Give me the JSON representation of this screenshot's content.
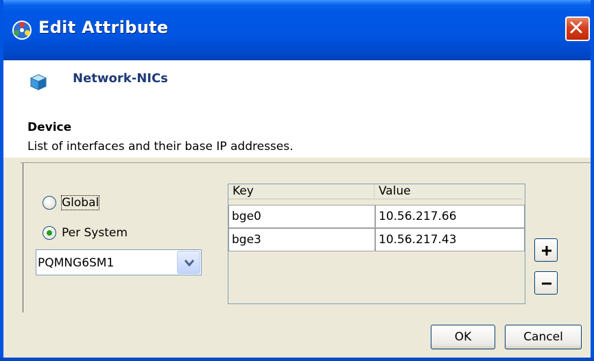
{
  "window": {
    "title": "Edit Attribute"
  },
  "header": {
    "title": "Network-NICs"
  },
  "section": {
    "title": "Device",
    "description": "List of interfaces and their base IP addresses."
  },
  "scope": {
    "global_label": "Global",
    "per_system_label": "Per System",
    "selected": "Per System",
    "system_value": "PQMNG6SM1"
  },
  "table": {
    "columns": [
      "Key",
      "Value"
    ],
    "rows": [
      {
        "key": "bge0",
        "value": "10.56.217.66"
      },
      {
        "key": "bge3",
        "value": "10.56.217.43"
      }
    ]
  },
  "buttons": {
    "add_label": "+",
    "remove_label": "−",
    "ok_label": "OK",
    "cancel_label": "Cancel"
  },
  "icons": {
    "app": "app-icon",
    "close": "close-icon",
    "cube": "cube-icon",
    "dropdown": "chevron-down-icon",
    "add": "plus-icon",
    "remove": "minus-icon"
  },
  "colors": {
    "titlebar": "#0055e0",
    "header_title": "#1e3a78",
    "radio_checked": "#21a121",
    "close_button": "#d4401f"
  }
}
